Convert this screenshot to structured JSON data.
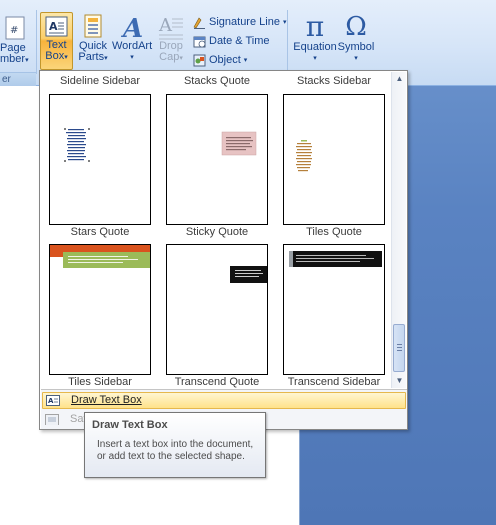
{
  "ribbon": {
    "page_number": {
      "line1": "Page",
      "line2": "mber"
    },
    "group_label": "er",
    "text_box": {
      "line1": "Text",
      "line2": "Box"
    },
    "quick_parts": {
      "line1": "Quick",
      "line2": "Parts"
    },
    "wordart": {
      "label": "WordArt"
    },
    "drop_cap": {
      "line1": "Drop",
      "line2": "Cap"
    },
    "signature_line": "Signature Line",
    "date_time": "Date & Time",
    "object": "Object",
    "equation": "Equation",
    "symbol": "Symbol",
    "dropdown_arrow": "▾",
    "pi_glyph": "π",
    "omega_glyph": "Ω"
  },
  "gallery": {
    "captions_top": [
      "Sideline Sidebar",
      "Stacks Quote",
      "Stacks Sidebar"
    ],
    "rows": [
      {
        "captions": [
          "Stars Quote",
          "Sticky Quote",
          "Tiles Quote"
        ]
      },
      {
        "captions": [
          "Tiles Sidebar",
          "Transcend Quote",
          "Transcend Sidebar"
        ]
      }
    ]
  },
  "menu": {
    "draw_text_box": "Draw Text Box",
    "save_selection": "Sav"
  },
  "tooltip": {
    "title": "Draw Text Box",
    "body": "Insert a text box into the document, or add text to the selected shape."
  },
  "colors": {
    "accent_highlight": "#f8b33c",
    "ribbon_text": "#15428b",
    "tiles_orange": "#d9531e",
    "tiles_green": "#9bbb59",
    "sticky_pink": "#e7c3c3"
  }
}
